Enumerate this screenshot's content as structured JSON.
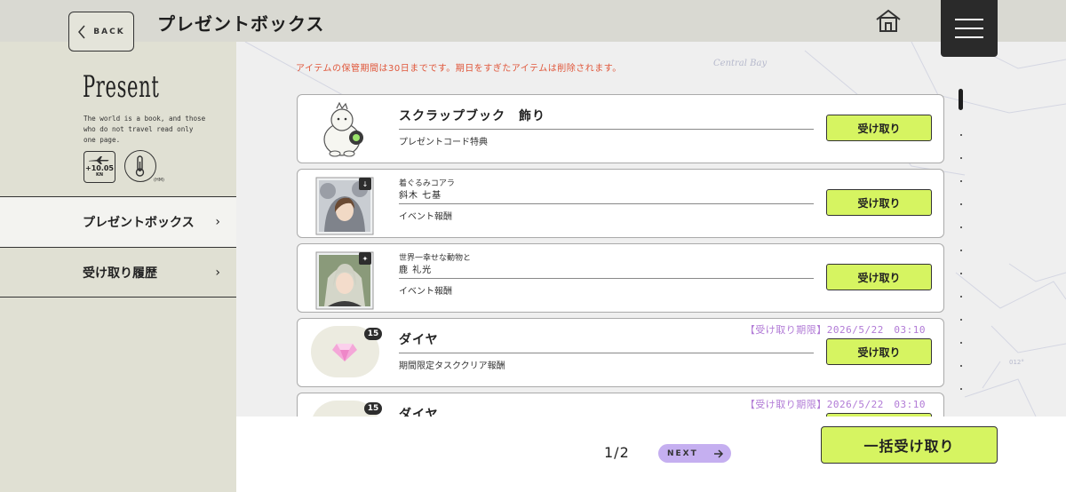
{
  "header": {
    "back_label": "BACK",
    "title": "プレゼントボックス",
    "home_icon": "home-icon",
    "menu_icon": "hamburger-menu-icon"
  },
  "sidebar": {
    "heading": "Present",
    "description": "The world is a book, and those who do not travel read only one page.",
    "badge_speed": {
      "value": "+10.05",
      "unit": "KN",
      "icon": "airplane-icon"
    },
    "badge_temp": {
      "unit": "(HM)",
      "icon": "thermometer-icon"
    },
    "items": [
      {
        "label": "プレゼントボックス",
        "active": true
      },
      {
        "label": "受け取り履歴",
        "active": false
      }
    ]
  },
  "main": {
    "notice": "アイテムの保管期間は30日までです。期日をすぎたアイテムは削除されます。",
    "map_label": "Central Bay",
    "map_heading": "012°",
    "claim_label": "受け取り",
    "items": [
      {
        "subtitle": "",
        "name": "スクラップブック　飾り",
        "source": "プレゼントコード特典",
        "deadline": "",
        "count": "",
        "thumb": "mascot-icon"
      },
      {
        "subtitle": "着ぐるみコアラ",
        "name": "斜木 七基",
        "source": "イベント報酬",
        "deadline": "",
        "count": "",
        "thumb": "character-card"
      },
      {
        "subtitle": "世界一幸せな動物と",
        "name": "鹿 礼光",
        "source": "イベント報酬",
        "deadline": "",
        "count": "",
        "thumb": "character-card"
      },
      {
        "subtitle": "",
        "name": "ダイヤ",
        "source": "期間限定タスククリア報酬",
        "deadline": "【受け取り期限】2026/5/22　03:10",
        "count": "15",
        "thumb": "diamond-icon"
      },
      {
        "subtitle": "",
        "name": "ダイヤ",
        "source": "",
        "deadline": "【受け取り期限】2026/5/22　03:10",
        "count": "15",
        "thumb": "diamond-icon"
      }
    ]
  },
  "footer": {
    "page_indicator": "1/2",
    "next_label": "NEXT",
    "claim_all_label": "一括受け取り"
  },
  "colors": {
    "accent_green": "#d6f461",
    "deadline_purple": "#b17ad6",
    "notice_red": "#e0573b",
    "next_purple": "#c5aff0"
  }
}
